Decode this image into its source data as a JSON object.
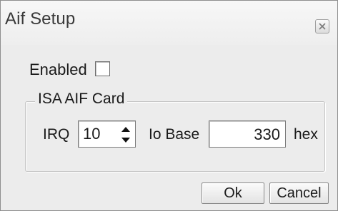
{
  "window": {
    "title": "Aif Setup",
    "close_icon": "close-icon"
  },
  "form": {
    "enabled_label": "Enabled",
    "enabled_checked": false,
    "group_title": "ISA AIF Card",
    "irq_label": "IRQ",
    "irq_value": "10",
    "iobase_label": "Io Base",
    "iobase_value": "330",
    "hex_label": "hex"
  },
  "buttons": {
    "ok_label": "Ok",
    "cancel_label": "Cancel"
  },
  "colors": {
    "window_bg": "#ececec",
    "border": "#8e8e8e"
  }
}
